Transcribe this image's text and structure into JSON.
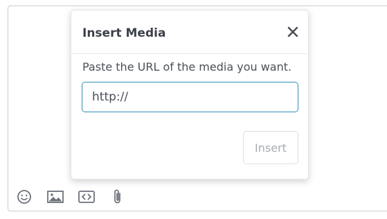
{
  "dialog": {
    "title": "Insert Media",
    "instruction": "Paste the URL of the media you want.",
    "url_value": "http://",
    "insert_label": "Insert",
    "close_icon": "close-icon"
  },
  "toolbar": {
    "icons": [
      "emoji-icon",
      "image-icon",
      "code-icon",
      "attachment-icon"
    ]
  },
  "colors": {
    "input_border": "#2d8fb5",
    "icon_gray": "#6b7079",
    "title_text": "#3c4049",
    "disabled_text": "#a7abb1"
  }
}
